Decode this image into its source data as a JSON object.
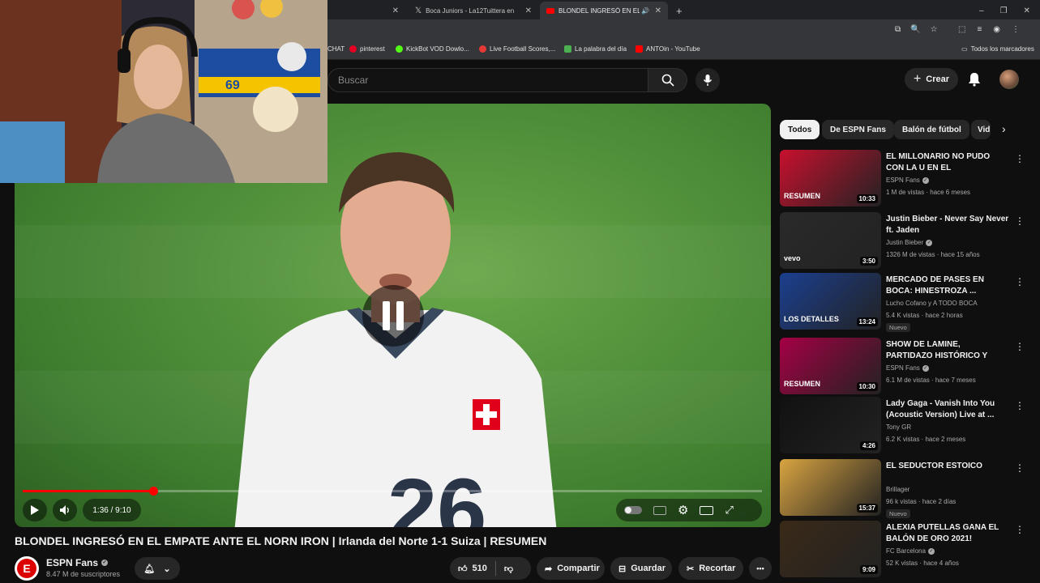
{
  "browser": {
    "tabs": [
      {
        "label": "Boca Juniors - La12Tuittera en",
        "icon": "x-icon"
      },
      {
        "label": "BLONDEL INGRESÓ EN EL E",
        "icon": "youtube-icon"
      }
    ],
    "new_tab": "+",
    "bookmarks": [
      {
        "label": "CHAT"
      },
      {
        "label": "pinterest"
      },
      {
        "label": "KickBot VOD Dowlo..."
      },
      {
        "label": "Live Football Scores,..."
      },
      {
        "label": "La palabra del día"
      },
      {
        "label": "ANTOin - YouTube"
      }
    ],
    "all_bookmarks": "Todos los marcadores"
  },
  "header": {
    "search_placeholder": "Buscar",
    "create_label": "Crear"
  },
  "player": {
    "time": "1:36 / 9:10",
    "progress_fraction": 0.176,
    "jersey_number": "26"
  },
  "video": {
    "title": "BLONDEL INGRESÓ EN EL EMPATE ANTE EL NORN IRON | Irlanda del Norte 1-1 Suiza | RESUMEN",
    "channel": "ESPN Fans",
    "subscribers": "8.47 M de suscriptores",
    "likes": "510",
    "share_label": "Compartir",
    "save_label": "Guardar",
    "clip_label": "Recortar",
    "more": "•••"
  },
  "chips": [
    "Todos",
    "De ESPN Fans",
    "Balón de fútbol",
    "Vid"
  ],
  "recommendations": [
    {
      "title": "EL MILLONARIO NO PUDO CON LA U EN EL MONUMENTAL | ...",
      "channel": "ESPN Fans",
      "verified": true,
      "meta": "1 M de vistas · hace 6 meses",
      "duration": "10:33",
      "badge": "",
      "thumb_color": "#c8102e",
      "thumb_text": "RESUMEN"
    },
    {
      "title": "Justin Bieber - Never Say Never ft. Jaden",
      "channel": "Justin Bieber",
      "verified": true,
      "meta": "1326 M de vistas · hace 15 años",
      "duration": "3:50",
      "badge": "",
      "thumb_color": "#2a2a2a",
      "thumb_text": "vevo"
    },
    {
      "title": "MERCADO DE PASES EN BOCA: HINESTROZA ...",
      "channel": "Lucho Cofano y A TODO BOCA",
      "verified": false,
      "meta": "5.4 K vistas · hace 2 horas",
      "duration": "13:24",
      "badge": "Nuevo",
      "thumb_color": "#1b3f8f",
      "thumb_text": "LOS DETALLES"
    },
    {
      "title": "SHOW DE LAMINE, PARTIDAZO HISTÓRICO Y EMPATE ENTRE ...",
      "channel": "ESPN Fans",
      "verified": true,
      "meta": "6.1 M de vistas · hace 7 meses",
      "duration": "10:30",
      "badge": "",
      "thumb_color": "#a50044",
      "thumb_text": "RESUMEN"
    },
    {
      "title": "Lady Gaga - Vanish Into You (Acoustic Version) Live at ...",
      "channel": "Tony GR",
      "verified": false,
      "meta": "6.2 K vistas · hace 2 meses",
      "duration": "4:26",
      "badge": "",
      "thumb_color": "#111111",
      "thumb_text": ""
    },
    {
      "title": "EL SEDUCTOR ESTOICO",
      "channel": "Brillager",
      "verified": false,
      "meta": "96 k vistas · hace 2 días",
      "duration": "15:37",
      "badge": "Nuevo",
      "thumb_color": "#d9a441",
      "thumb_text": ""
    },
    {
      "title": "ALEXIA PUTELLAS GANA EL BALÓN DE ORO 2021!",
      "channel": "FC Barcelona",
      "verified": true,
      "meta": "52 K vistas · hace 4 años",
      "duration": "9:09",
      "badge": "",
      "thumb_color": "#3a2a18",
      "thumb_text": ""
    }
  ],
  "webcam": {
    "number": "69"
  }
}
